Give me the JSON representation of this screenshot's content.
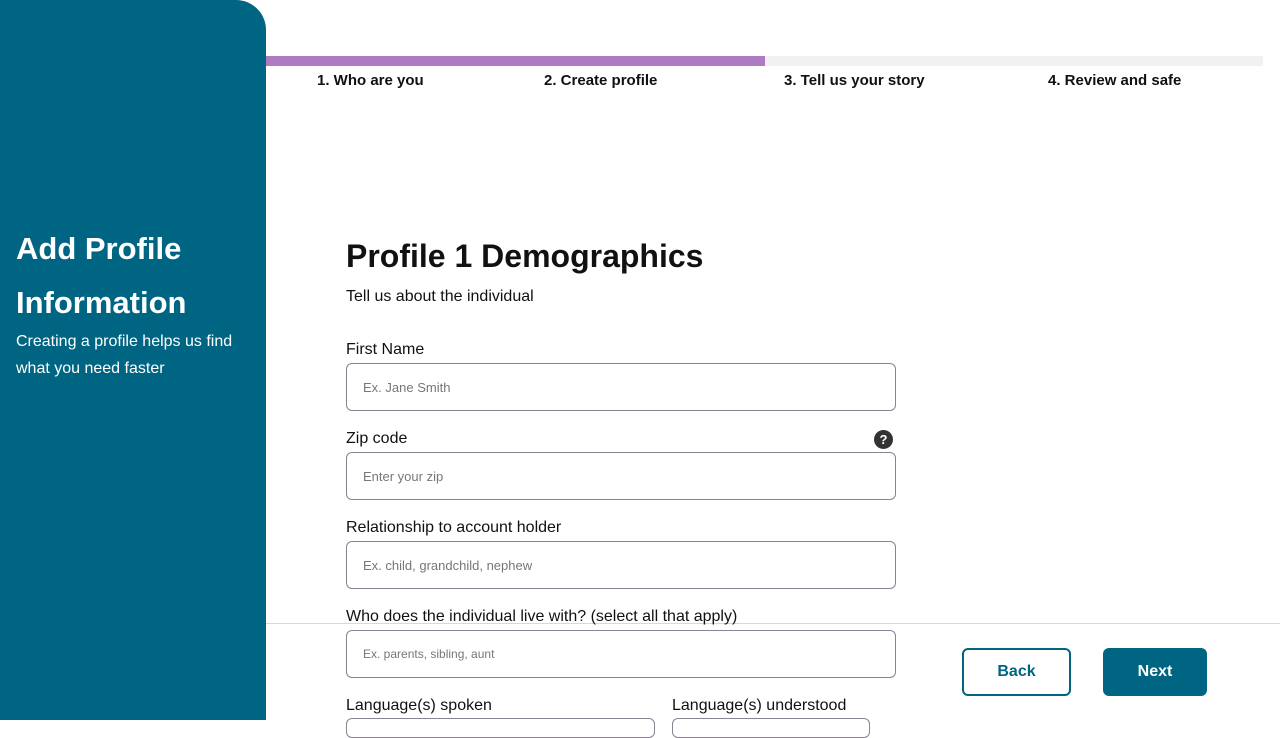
{
  "sidebar": {
    "title": "Add Profile Information",
    "description": "Creating a profile helps us find what you need faster"
  },
  "progress": {
    "percent": 50,
    "steps": [
      "1. Who are you",
      "2. Create profile",
      "3. Tell us your story",
      "4. Review and safe"
    ]
  },
  "form": {
    "title": "Profile 1 Demographics",
    "subtitle": "Tell us about the individual",
    "first_name": {
      "label": "First Name",
      "placeholder": "Ex. Jane Smith"
    },
    "zip": {
      "label": "Zip code",
      "placeholder": "Enter your zip",
      "help": "?"
    },
    "relationship": {
      "label": "Relationship to account holder",
      "placeholder": "Ex. child, grandchild, nephew"
    },
    "lives_with": {
      "label": "Who does the individual live with? (select all that apply)",
      "placeholder": "Ex. parents, sibling, aunt"
    },
    "languages_spoken": {
      "label": "Language(s) spoken"
    },
    "languages_understood": {
      "label": "Language(s) understood"
    }
  },
  "footer": {
    "back": "Back",
    "next": "Next"
  }
}
